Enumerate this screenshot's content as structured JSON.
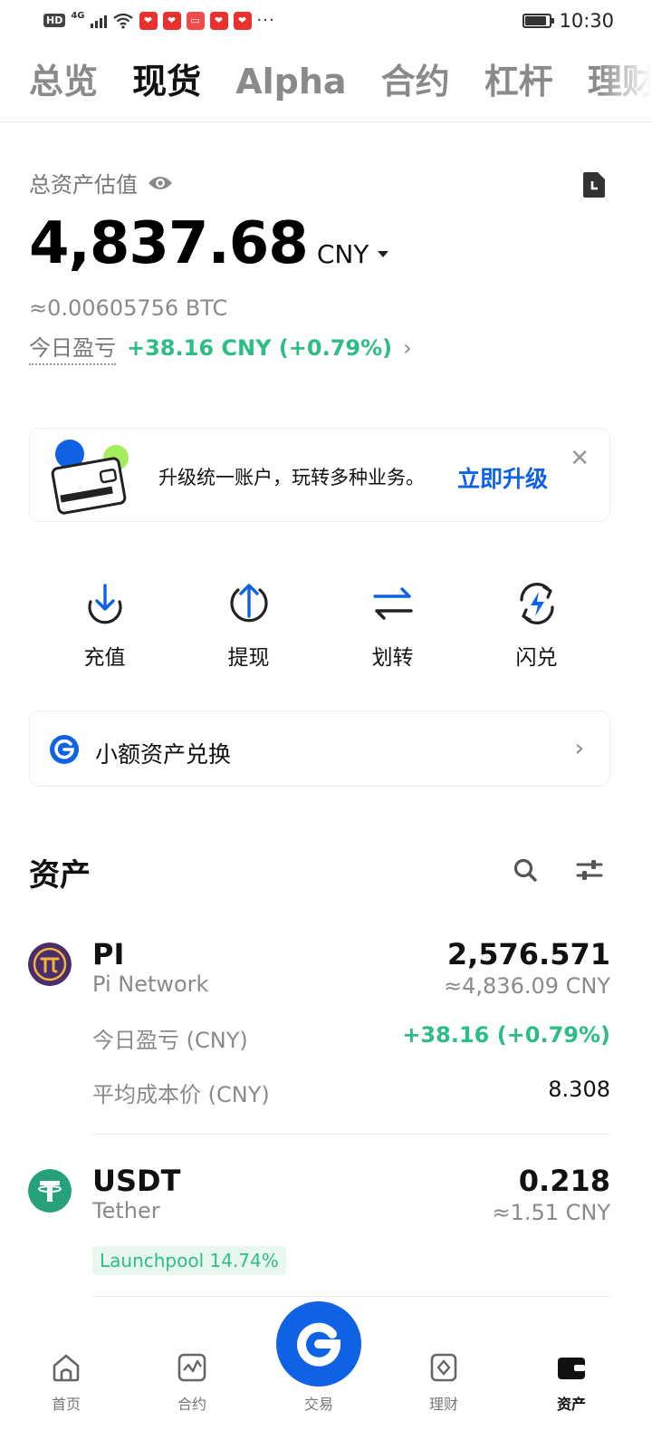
{
  "status_bar": {
    "hd": "HD",
    "network": "4G",
    "time": "10:30",
    "more": "···"
  },
  "top_tabs": [
    {
      "label": "总览",
      "active": false
    },
    {
      "label": "现货",
      "active": true
    },
    {
      "label": "Alpha",
      "active": false
    },
    {
      "label": "合约",
      "active": false
    },
    {
      "label": "杠杆",
      "active": false
    },
    {
      "label": "理财",
      "active": false
    }
  ],
  "summary": {
    "label": "总资产估值",
    "total_value": "4,837.68",
    "currency": "CNY",
    "btc_value": "≈0.00605756 BTC",
    "pnl_label": "今日盈亏",
    "pnl_value": "+38.16 CNY (+0.79%)"
  },
  "banner": {
    "text": "升级统一账户，玩转多种业务。",
    "link": "立即升级",
    "close": "✕"
  },
  "actions": [
    {
      "label": "充值",
      "icon": "deposit-icon"
    },
    {
      "label": "提现",
      "icon": "withdraw-icon"
    },
    {
      "label": "划转",
      "icon": "transfer-icon"
    },
    {
      "label": "闪兑",
      "icon": "flash-swap-icon"
    }
  ],
  "convert": {
    "label": "小额资产兑换"
  },
  "assets": {
    "title": "资产",
    "items": [
      {
        "symbol": "PI",
        "name": "Pi Network",
        "amount": "2,576.571",
        "fiat": "≈4,836.09 CNY",
        "pnl_label": "今日盈亏 (CNY)",
        "pnl_value": "+38.16 (+0.79%)",
        "cost_label": "平均成本价 (CNY)",
        "cost_value": "8.308"
      },
      {
        "symbol": "USDT",
        "name": "Tether",
        "amount": "0.218",
        "fiat": "≈1.51 CNY",
        "badge": "Launchpool 14.74%"
      }
    ]
  },
  "bottom_nav": [
    {
      "label": "首页",
      "icon": "home-icon",
      "active": false
    },
    {
      "label": "合约",
      "icon": "futures-icon",
      "active": false
    },
    {
      "label": "交易",
      "icon": "trade-icon",
      "active": false
    },
    {
      "label": "理财",
      "icon": "earn-icon",
      "active": false
    },
    {
      "label": "资产",
      "icon": "wallet-icon",
      "active": true
    }
  ],
  "colors": {
    "accent": "#1062e5",
    "positive": "#2ebd85",
    "pi_brand": "#4a2d6b",
    "tether_brand": "#26a17b"
  }
}
